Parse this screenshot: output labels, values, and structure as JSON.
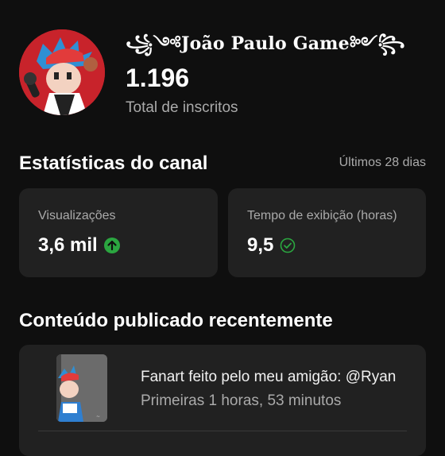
{
  "channel": {
    "name": "꧁༺João Paulo Game༻꧂",
    "subscriber_count": "1.196",
    "subscriber_label": "Total de inscritos"
  },
  "stats_section": {
    "title": "Estatísticas do canal",
    "period": "Últimos 28 dias",
    "cards": [
      {
        "label": "Visualizações",
        "value": "3,6 mil",
        "indicator_icon": "arrow-up-icon",
        "indicator_color": "#2ba640"
      },
      {
        "label": "Tempo de exibição (horas)",
        "value": "9,5",
        "indicator_icon": "check-circle-icon",
        "indicator_color": "#2ba640"
      }
    ]
  },
  "recent_section": {
    "title": "Conteúdo publicado recentemente",
    "videos": [
      {
        "title": "Fanart feito pelo meu amigão: @Ryan",
        "meta": "Primeiras 1 horas, 53 minutos"
      }
    ]
  },
  "colors": {
    "background": "#0f0f0f",
    "card": "#212121",
    "accent_green": "#2ba640",
    "avatar_red": "#c8232b"
  }
}
